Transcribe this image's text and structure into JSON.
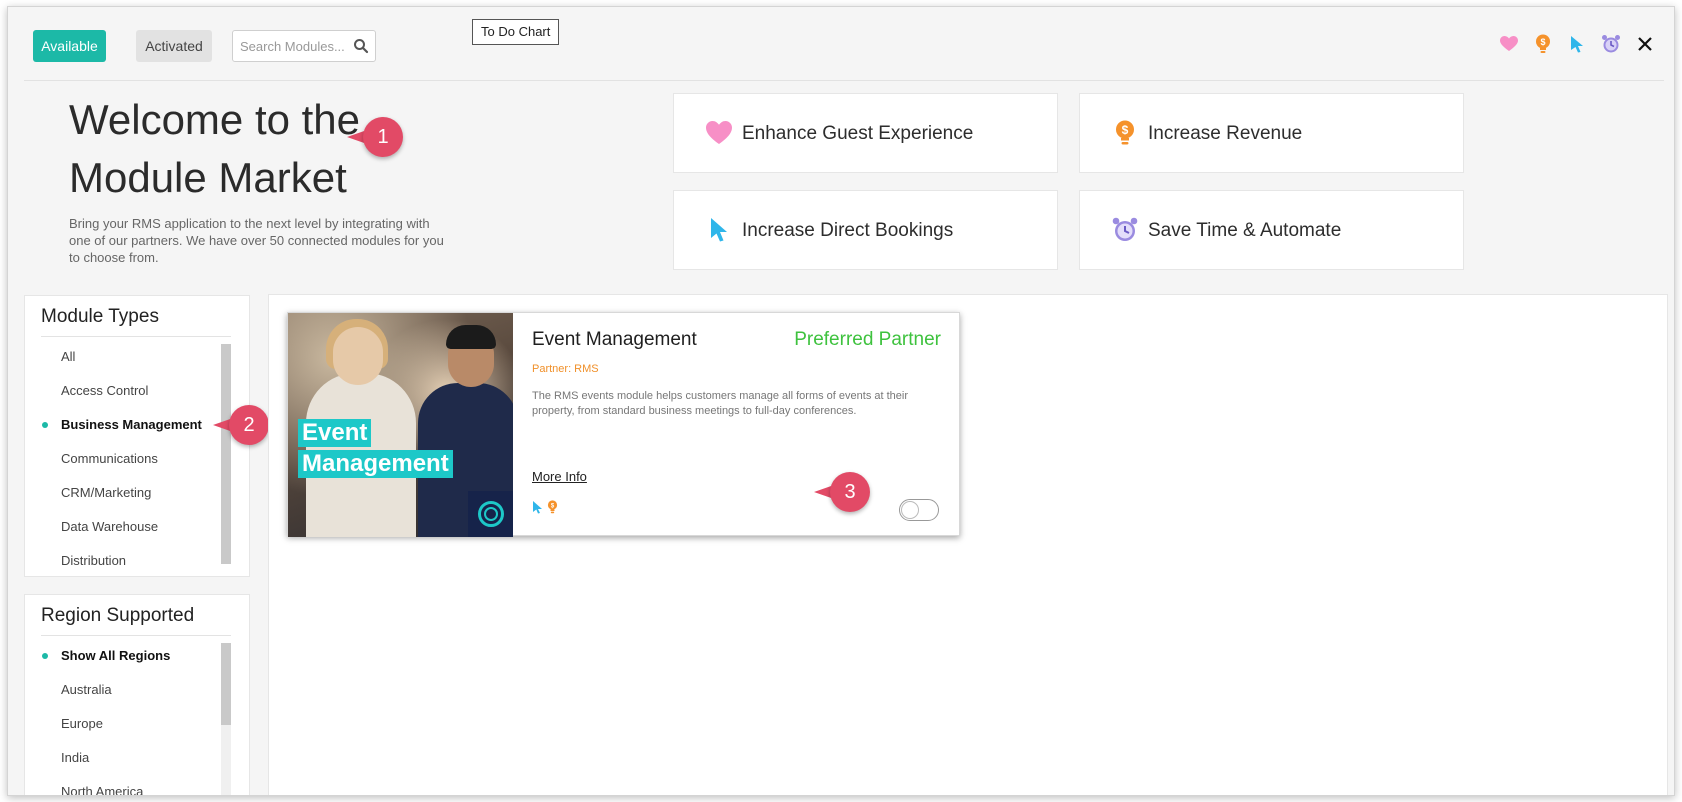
{
  "topbar": {
    "tab_available": "Available",
    "tab_activated": "Activated",
    "search_placeholder": "Search Modules...",
    "tooltip": "To Do Chart"
  },
  "hero": {
    "title_line1": "Welcome to the",
    "title_line2": "Module Market",
    "description": "Bring your RMS application to the next level by integrating with one of our partners. We have over 50 connected modules for you to choose from."
  },
  "goals": [
    {
      "label": "Enhance Guest Experience",
      "icon": "heart-icon",
      "color": "#f78fc6"
    },
    {
      "label": "Increase Revenue",
      "icon": "lightbulb-dollar-icon",
      "color": "#f5922b"
    },
    {
      "label": "Increase Direct Bookings",
      "icon": "cursor-icon",
      "color": "#2fb6ea"
    },
    {
      "label": "Save Time & Automate",
      "icon": "alarm-clock-icon",
      "color": "#9a8be0"
    }
  ],
  "module_types": {
    "title": "Module Types",
    "items": [
      "All",
      "Access Control",
      "Business Management",
      "Communications",
      "CRM/Marketing",
      "Data Warehouse",
      "Distribution"
    ],
    "selected": "Business Management"
  },
  "regions": {
    "title": "Region Supported",
    "items": [
      "Show All Regions",
      "Australia",
      "Europe",
      "India",
      "North America"
    ],
    "selected": "Show All Regions"
  },
  "card": {
    "title": "Event Management",
    "badge": "Preferred Partner",
    "partner": "Partner: RMS",
    "description": "The RMS events module helps customers manage all forms of events at their property, from standard business meetings to full-day conferences.",
    "more_info": "More Info",
    "image_tag_line1": "Event",
    "image_tag_line2": "Management",
    "toggle_on": false
  },
  "callouts": [
    "1",
    "2",
    "3"
  ],
  "colors": {
    "accent": "#1cb9a7",
    "callout": "#e24a66",
    "preferred": "#3ec23e",
    "partner": "#f0902a"
  }
}
